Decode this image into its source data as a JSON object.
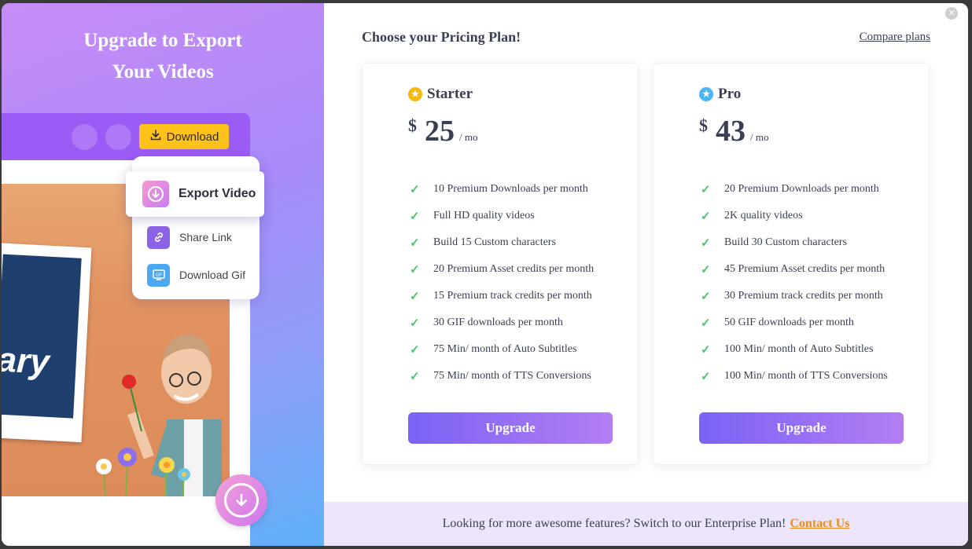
{
  "left": {
    "title_line1": "Upgrade to Export",
    "title_line2": "Your Videos",
    "toolbar": {
      "download_label": "Download"
    },
    "menu": {
      "export_label": "Export Video",
      "share_label": "Share Link",
      "gif_label": "Download Gif"
    },
    "scene_text": "ary"
  },
  "header": {
    "title": "Choose your Pricing Plan!",
    "compare_label": "Compare plans"
  },
  "plans": [
    {
      "name": "Starter",
      "currency": "$",
      "price": "25",
      "period": "/ mo",
      "star_color": "#f5b90f",
      "features": [
        "10 Premium Downloads per month",
        "Full HD quality videos",
        "Build 15 Custom characters",
        "20 Premium Asset credits per month",
        "15 Premium track credits per month",
        "30 GIF downloads per month",
        "75 Min/ month of Auto Subtitles",
        "75 Min/ month of TTS Conversions"
      ],
      "cta": "Upgrade"
    },
    {
      "name": "Pro",
      "currency": "$",
      "price": "43",
      "period": "/ mo",
      "star_color": "#4ab6f3",
      "features": [
        "20 Premium Downloads per month",
        "2K quality videos",
        "Build 30 Custom characters",
        "45 Premium Asset credits per month",
        "30 Premium track credits per month",
        "50 GIF downloads per month",
        "100 Min/ month of Auto Subtitles",
        "100 Min/ month of TTS Conversions"
      ],
      "cta": "Upgrade"
    }
  ],
  "footer": {
    "text": "Looking for more awesome features? Switch to our Enterprise Plan!",
    "link": "Contact Us"
  },
  "colors": {
    "accent": "#7b62f5",
    "check": "#4cc46a",
    "contact_link": "#f08a1c",
    "download_button": "#ffc21a"
  }
}
